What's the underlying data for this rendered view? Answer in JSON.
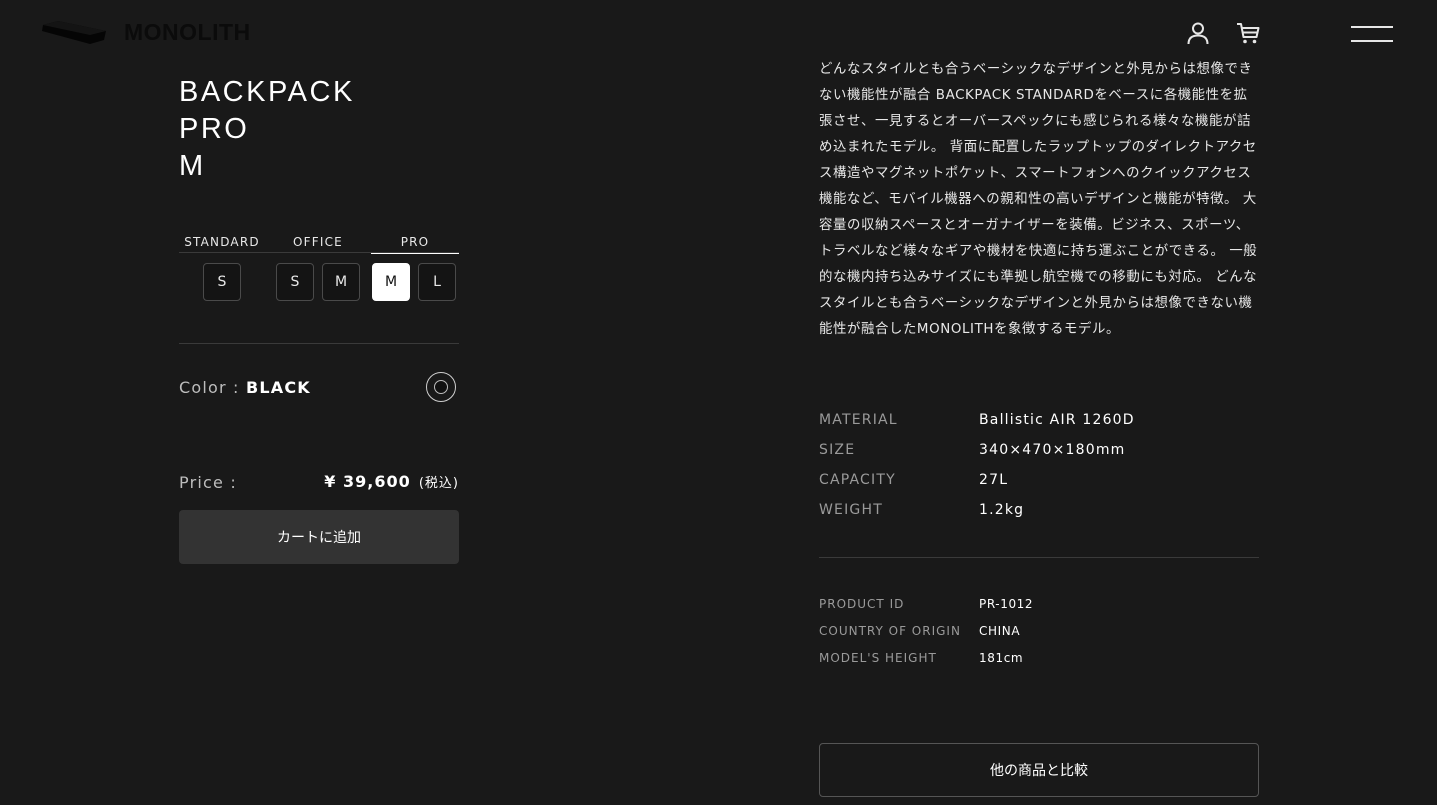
{
  "header": {
    "brand": "MONOLITH",
    "icons": {
      "account": "user-icon",
      "cart": "cart-icon",
      "menu": "hamburger-menu-icon"
    }
  },
  "product": {
    "title_lines": [
      "BACKPACK",
      "PRO",
      "M"
    ],
    "lines": [
      {
        "label": "STANDARD",
        "sizes": [
          "S"
        ]
      },
      {
        "label": "OFFICE",
        "sizes": [
          "S",
          "M"
        ]
      },
      {
        "label": "PRO",
        "sizes": [
          "M",
          "L"
        ]
      }
    ],
    "selected_line": "PRO",
    "selected_size": "M",
    "color_label": "Color :",
    "color_value": "BLACK",
    "swatch_color": "#111111",
    "price_label": "Price :",
    "price_amount": "¥ 39,600",
    "price_tax": "(税込)",
    "add_to_cart": "カートに追加"
  },
  "description": "どんなスタイルとも合うベーシックなデザインと外見からは想像できない機能性が融合 BACKPACK STANDARDをベースに各機能性を拡張させ、一見するとオーバースペックにも感じられる様々な機能が詰め込まれたモデル。 背面に配置したラップトップのダイレクトアクセス構造やマグネットポケット、スマートフォンへのクイックアクセス機能など、モバイル機器への親和性の高いデザインと機能が特徴。 大容量の収納スペースとオーガナイザーを装備。ビジネス、スポーツ、トラベルなど様々なギアや機材を快適に持ち運ぶことができる。 一般的な機内持ち込みサイズにも準拠し航空機での移動にも対応。 どんなスタイルとも合うベーシックなデザインと外見からは想像できない機能性が融合したMONOLITHを象徴するモデル。",
  "specs": [
    {
      "key": "MATERIAL",
      "value": "Ballistic AIR 1260D"
    },
    {
      "key": "SIZE",
      "value": "340×470×180mm"
    },
    {
      "key": "CAPACITY",
      "value": "27L"
    },
    {
      "key": "WEIGHT",
      "value": "1.2kg"
    }
  ],
  "info": [
    {
      "key": "PRODUCT ID",
      "value": "PR-1012"
    },
    {
      "key": "COUNTRY OF ORIGIN",
      "value": "CHINA"
    },
    {
      "key": "MODEL'S HEIGHT",
      "value": "181cm"
    }
  ],
  "compare_label": "他の商品と比較"
}
